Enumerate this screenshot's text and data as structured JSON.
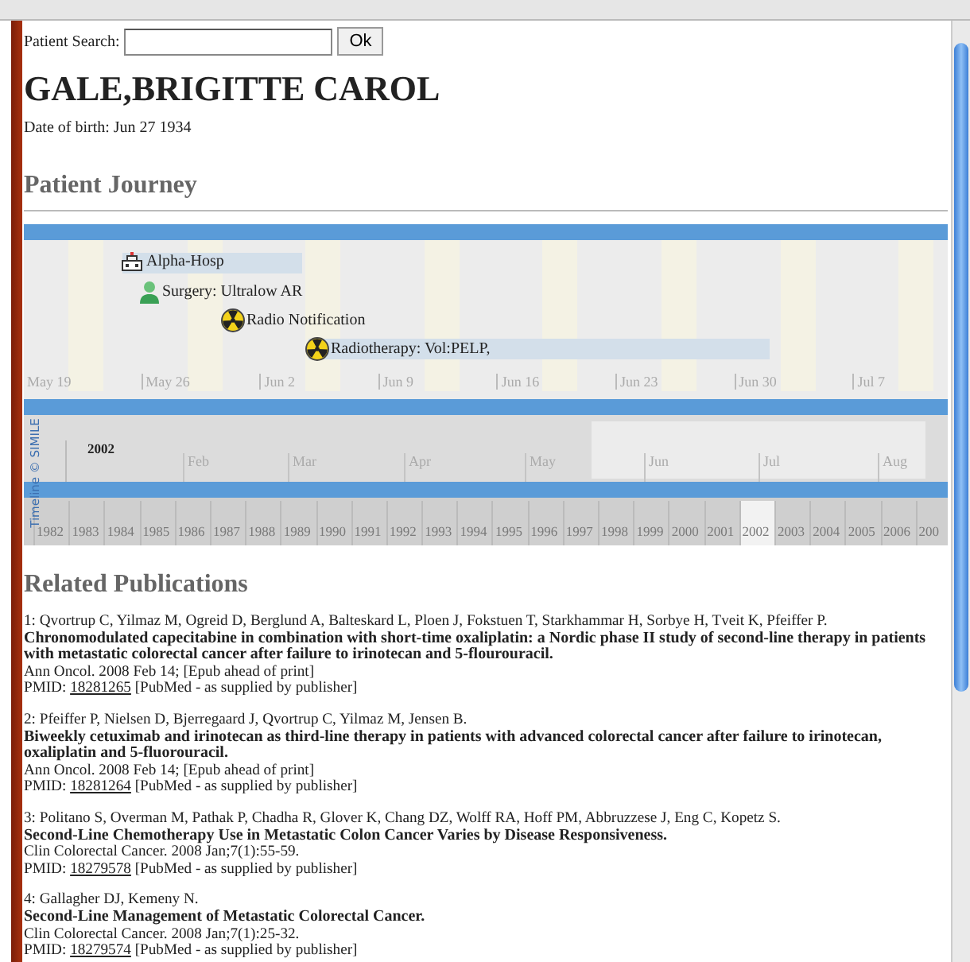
{
  "search": {
    "label": "Patient Search:",
    "button": "Ok"
  },
  "patient": {
    "name": "GALE,BRIGITTE CAROL",
    "dob": "Date of birth: Jun 27 1934"
  },
  "journey": {
    "heading": "Patient Journey",
    "events": [
      {
        "kind": "hospital",
        "label": "Alpha-Hosp",
        "bar": true
      },
      {
        "kind": "surgery",
        "label": "Surgery: Ultralow AR",
        "bar": false
      },
      {
        "kind": "radiation",
        "label": "Radio Notification",
        "bar": false
      },
      {
        "kind": "radiation",
        "label": "Radiotherapy: Vol:PELP,",
        "bar": true
      }
    ],
    "week_labels": [
      "May 19",
      "May 26",
      "Jun 2",
      "Jun 9",
      "Jun 16",
      "Jun 23",
      "Jun 30",
      "Jul 7"
    ],
    "overview": {
      "year": "2002",
      "months": [
        "Feb",
        "Mar",
        "Apr",
        "May",
        "Jun",
        "Jul",
        "Aug"
      ]
    },
    "years": [
      {
        "label": "1982",
        "selected": false
      },
      {
        "label": "1983",
        "selected": false
      },
      {
        "label": "1984",
        "selected": false
      },
      {
        "label": "1985",
        "selected": false
      },
      {
        "label": "1986",
        "selected": false
      },
      {
        "label": "1987",
        "selected": false
      },
      {
        "label": "1988",
        "selected": false
      },
      {
        "label": "1989",
        "selected": false
      },
      {
        "label": "1990",
        "selected": false
      },
      {
        "label": "1991",
        "selected": false
      },
      {
        "label": "1992",
        "selected": false
      },
      {
        "label": "1993",
        "selected": false
      },
      {
        "label": "1994",
        "selected": false
      },
      {
        "label": "1995",
        "selected": false
      },
      {
        "label": "1996",
        "selected": false
      },
      {
        "label": "1997",
        "selected": false
      },
      {
        "label": "1998",
        "selected": false
      },
      {
        "label": "1999",
        "selected": false
      },
      {
        "label": "2000",
        "selected": false
      },
      {
        "label": "2001",
        "selected": false
      },
      {
        "label": "2002",
        "selected": true
      },
      {
        "label": "2003",
        "selected": false
      },
      {
        "label": "2004",
        "selected": false
      },
      {
        "label": "2005",
        "selected": false
      },
      {
        "label": "2006",
        "selected": false
      },
      {
        "label": "200",
        "selected": false
      }
    ],
    "credit": "Timeline © SIMILE"
  },
  "publications": {
    "heading": "Related Publications",
    "items": [
      {
        "authors": "1: Qvortrup C, Yilmaz M, Ogreid D, Berglund A, Balteskard L, Ploen J, Fokstuen T, Starkhammar H, Sorbye H, Tveit K, Pfeiffer P.",
        "title": "Chronomodulated capecitabine in combination with short-time oxaliplatin: a Nordic phase II study of second-line therapy in patients with metastatic colorectal cancer after failure to irinotecan and 5-flourouracil.",
        "source": "Ann Oncol. 2008 Feb 14; [Epub ahead of print]",
        "pmid_label": "PMID:",
        "pmid": "18281265",
        "pmid_note": "[PubMed - as supplied by publisher]"
      },
      {
        "authors": "2: Pfeiffer P, Nielsen D, Bjerregaard J, Qvortrup C, Yilmaz M, Jensen B.",
        "title": "Biweekly cetuximab and irinotecan as third-line therapy in patients with advanced colorectal cancer after failure to irinotecan, oxaliplatin and 5-fluorouracil.",
        "source": "Ann Oncol. 2008 Feb 14; [Epub ahead of print]",
        "pmid_label": "PMID:",
        "pmid": "18281264",
        "pmid_note": "[PubMed - as supplied by publisher]"
      },
      {
        "authors": "3: Politano S, Overman M, Pathak P, Chadha R, Glover K, Chang DZ, Wolff RA, Hoff PM, Abbruzzese J, Eng C, Kopetz S.",
        "title": "Second-Line Chemotherapy Use in Metastatic Colon Cancer Varies by Disease Responsiveness.",
        "source": "Clin Colorectal Cancer. 2008 Jan;7(1):55-59.",
        "pmid_label": "PMID:",
        "pmid": "18279578",
        "pmid_note": "[PubMed - as supplied by publisher]"
      },
      {
        "authors": "4: Gallagher DJ, Kemeny N.",
        "title": "Second-Line Management of Metastatic Colorectal Cancer.",
        "source": "Clin Colorectal Cancer. 2008 Jan;7(1):25-32.",
        "pmid_label": "PMID:",
        "pmid": "18279574",
        "pmid_note": "[PubMed - as supplied by publisher]"
      }
    ]
  }
}
